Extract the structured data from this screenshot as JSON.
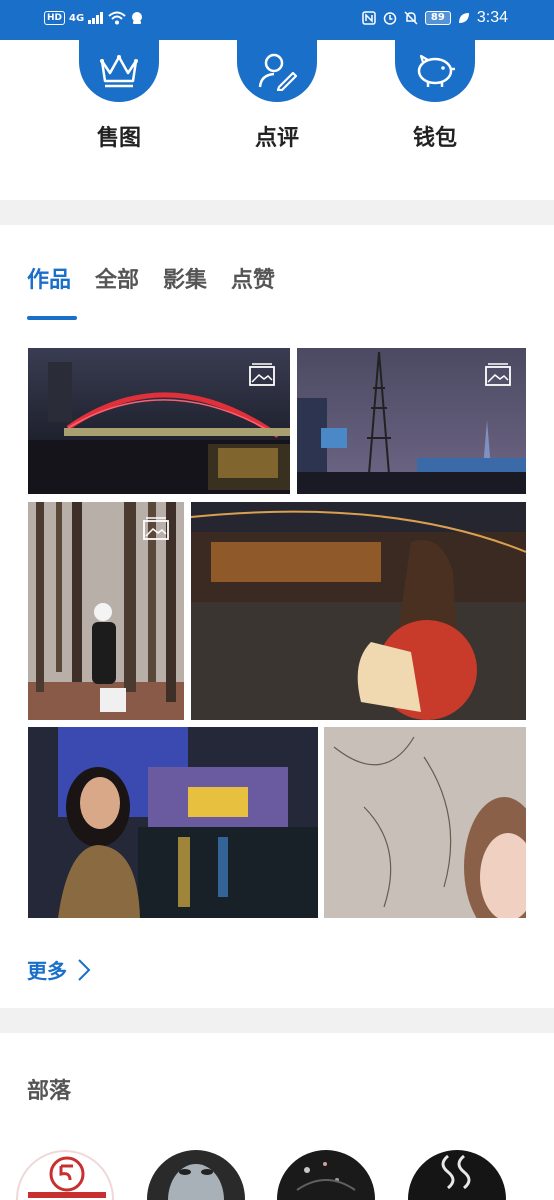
{
  "status_bar": {
    "left_badge": "HD",
    "network": "4G",
    "battery": "89",
    "time": "3:34"
  },
  "features": [
    {
      "label": "售图",
      "icon": "crown-icon"
    },
    {
      "label": "点评",
      "icon": "user-edit-icon"
    },
    {
      "label": "钱包",
      "icon": "piggy-bank-icon"
    }
  ],
  "tabs": [
    {
      "label": "作品",
      "active": true
    },
    {
      "label": "全部",
      "active": false
    },
    {
      "label": "影集",
      "active": false
    },
    {
      "label": "点赞",
      "active": false
    }
  ],
  "gallery": {
    "photos": [
      {
        "subject": "night bridge with red arch lights",
        "album": true
      },
      {
        "subject": "power tower and city lights in fog",
        "album": true
      },
      {
        "subject": "woman in white cap in pine forest",
        "album": true
      },
      {
        "subject": "woman in red dress by river at night",
        "album": false
      },
      {
        "subject": "woman by colorful city canal at night",
        "album": false
      },
      {
        "subject": "woman peeking beside vine-covered wall",
        "album": false
      }
    ],
    "more_label": "更多"
  },
  "tribe": {
    "title": "部落",
    "avatars": [
      "tribe-logo-avatar",
      "face-avatar",
      "dark-avatar",
      "photography-avatar"
    ]
  },
  "colors": {
    "accent": "#1a6fc9",
    "divider": "#f1f1f2"
  }
}
